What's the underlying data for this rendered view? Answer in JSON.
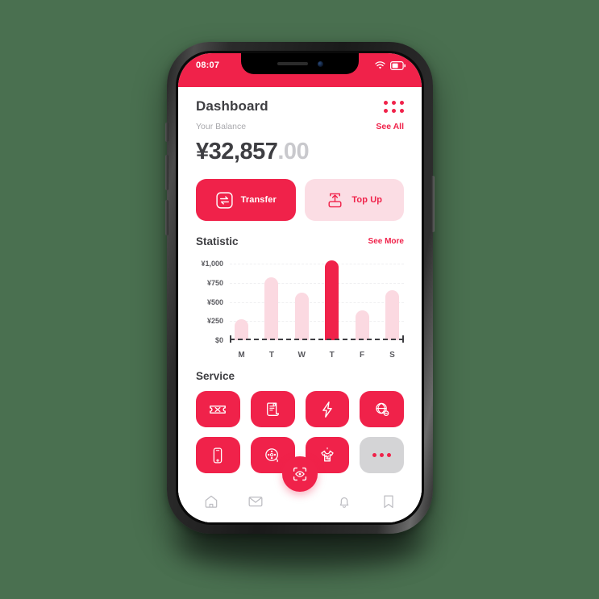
{
  "theme": {
    "accent": "#f0224a",
    "accent_soft": "#fbdde4",
    "bar_soft": "#fbd9e1",
    "text_dark": "#3e3e42",
    "text_muted": "#a9a9ad",
    "page_background": "#4a7050",
    "more_tile": "#d4d4d6"
  },
  "status_bar": {
    "time": "08:07",
    "wifi_icon": "wifi-icon",
    "battery_icon": "battery-icon"
  },
  "header": {
    "title": "Dashboard",
    "menu_icon": "grid-menu-icon",
    "balance_label": "Your Balance",
    "see_all_label": "See All"
  },
  "balance": {
    "whole": "¥32,857",
    "cents": ".00"
  },
  "actions": [
    {
      "label": "Transfer",
      "icon": "transfer-icon",
      "style": "primary"
    },
    {
      "label": "Top Up",
      "icon": "upload-icon",
      "style": "soft"
    }
  ],
  "statistic": {
    "title": "Statistic",
    "see_more_label": "See More"
  },
  "chart_data": {
    "type": "bar",
    "title": "Statistic",
    "categories": [
      "M",
      "T",
      "W",
      "T",
      "F",
      "S"
    ],
    "values": [
      280,
      820,
      620,
      1050,
      390,
      660
    ],
    "highlight_index": 3,
    "ytick_labels": [
      "¥1,000",
      "¥750",
      "¥500",
      "¥250",
      "$0"
    ],
    "ytick_values": [
      1000,
      750,
      500,
      250,
      0
    ],
    "ylim": [
      0,
      1100
    ],
    "xlabel": "",
    "ylabel": "",
    "grid": true,
    "grid_style": "dashed",
    "legend": "none",
    "bar_color": "#fbd9e1",
    "highlight_color": "#f0224a",
    "axis_style": "dashed"
  },
  "service": {
    "title": "Service",
    "items": [
      {
        "label": "Ticket",
        "icon": "ticket-icon"
      },
      {
        "label": "Bill",
        "icon": "invoice-icon"
      },
      {
        "label": "Electricity",
        "icon": "lightning-icon"
      },
      {
        "label": "Internet",
        "icon": "globe-icon"
      },
      {
        "label": "Mobile",
        "icon": "phone-icon"
      },
      {
        "label": "Movie",
        "icon": "film-reel-icon"
      },
      {
        "label": "Shopping",
        "icon": "shirt-discount-icon"
      },
      {
        "label": "More",
        "icon": "more-dots-icon"
      }
    ]
  },
  "bottom_nav": {
    "items": [
      {
        "label": "Home",
        "icon": "home-icon"
      },
      {
        "label": "Messages",
        "icon": "envelope-icon"
      },
      {
        "label": "Notifications",
        "icon": "bell-icon"
      },
      {
        "label": "Bookmarks",
        "icon": "bookmark-icon"
      }
    ],
    "fab": {
      "label": "Scan",
      "icon": "scan-eye-icon"
    }
  }
}
